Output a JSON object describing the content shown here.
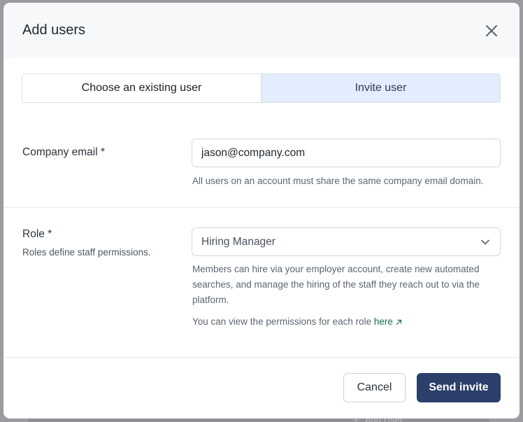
{
  "modal": {
    "title": "Add users",
    "close_icon": "close-icon"
  },
  "tabs": {
    "existing_label": "Choose an existing user",
    "invite_label": "Invite user",
    "active": "invite"
  },
  "email": {
    "label": "Company email *",
    "value": "jason@company.com",
    "help": "All users on an account must share the same company email domain."
  },
  "role": {
    "label": "Role *",
    "sublabel": "Roles define staff permissions.",
    "selected": "Hiring Manager",
    "description": "Members can hire via your employer account, create new automated searches, and manage the hiring of the staff they reach out to via the platform.",
    "permissions_text": "You can view the permissions for each role ",
    "permissions_link": "here",
    "link_icon": "external-arrow-icon",
    "dropdown_icon": "chevron-down-icon"
  },
  "footer": {
    "cancel_label": "Cancel",
    "send_label": "Send invite"
  },
  "background": {
    "add_user_label": "Add User"
  },
  "colors": {
    "primary": "#2b3f6a",
    "active_tab": "#e3edfd",
    "link": "#1c6b4a"
  }
}
